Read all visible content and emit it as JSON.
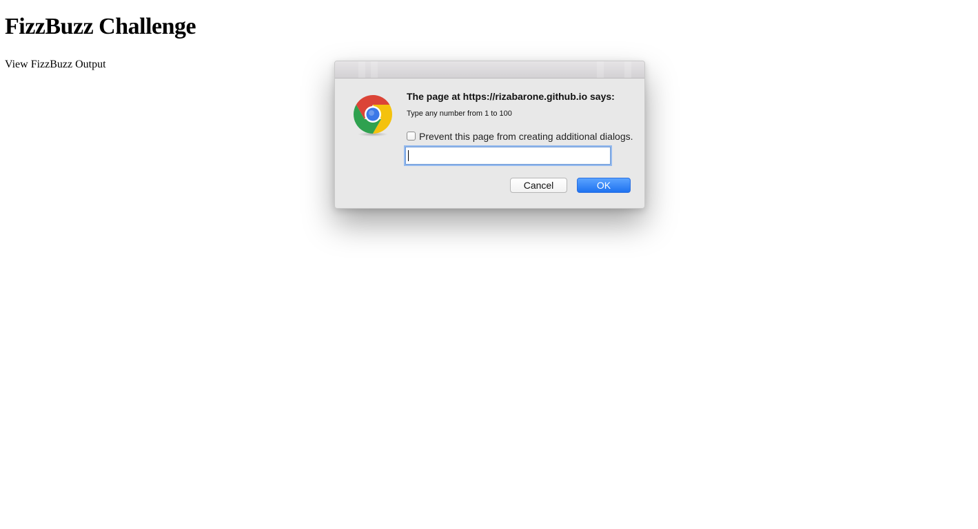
{
  "page": {
    "title": "FizzBuzz Challenge",
    "link_text": "View FizzBuzz Output"
  },
  "dialog": {
    "heading": "The page at https://rizabarone.github.io says:",
    "message": "Type any number from 1 to 100",
    "prevent_label": "Prevent this page from creating additional dialogs.",
    "prevent_checked": false,
    "input_value": "",
    "cancel_label": "Cancel",
    "ok_label": "OK",
    "icon": "chrome-logo-icon"
  },
  "colors": {
    "ok_button": "#1e72f0",
    "input_focus": "#93b9ee",
    "dialog_bg": "#e8e8e8"
  }
}
